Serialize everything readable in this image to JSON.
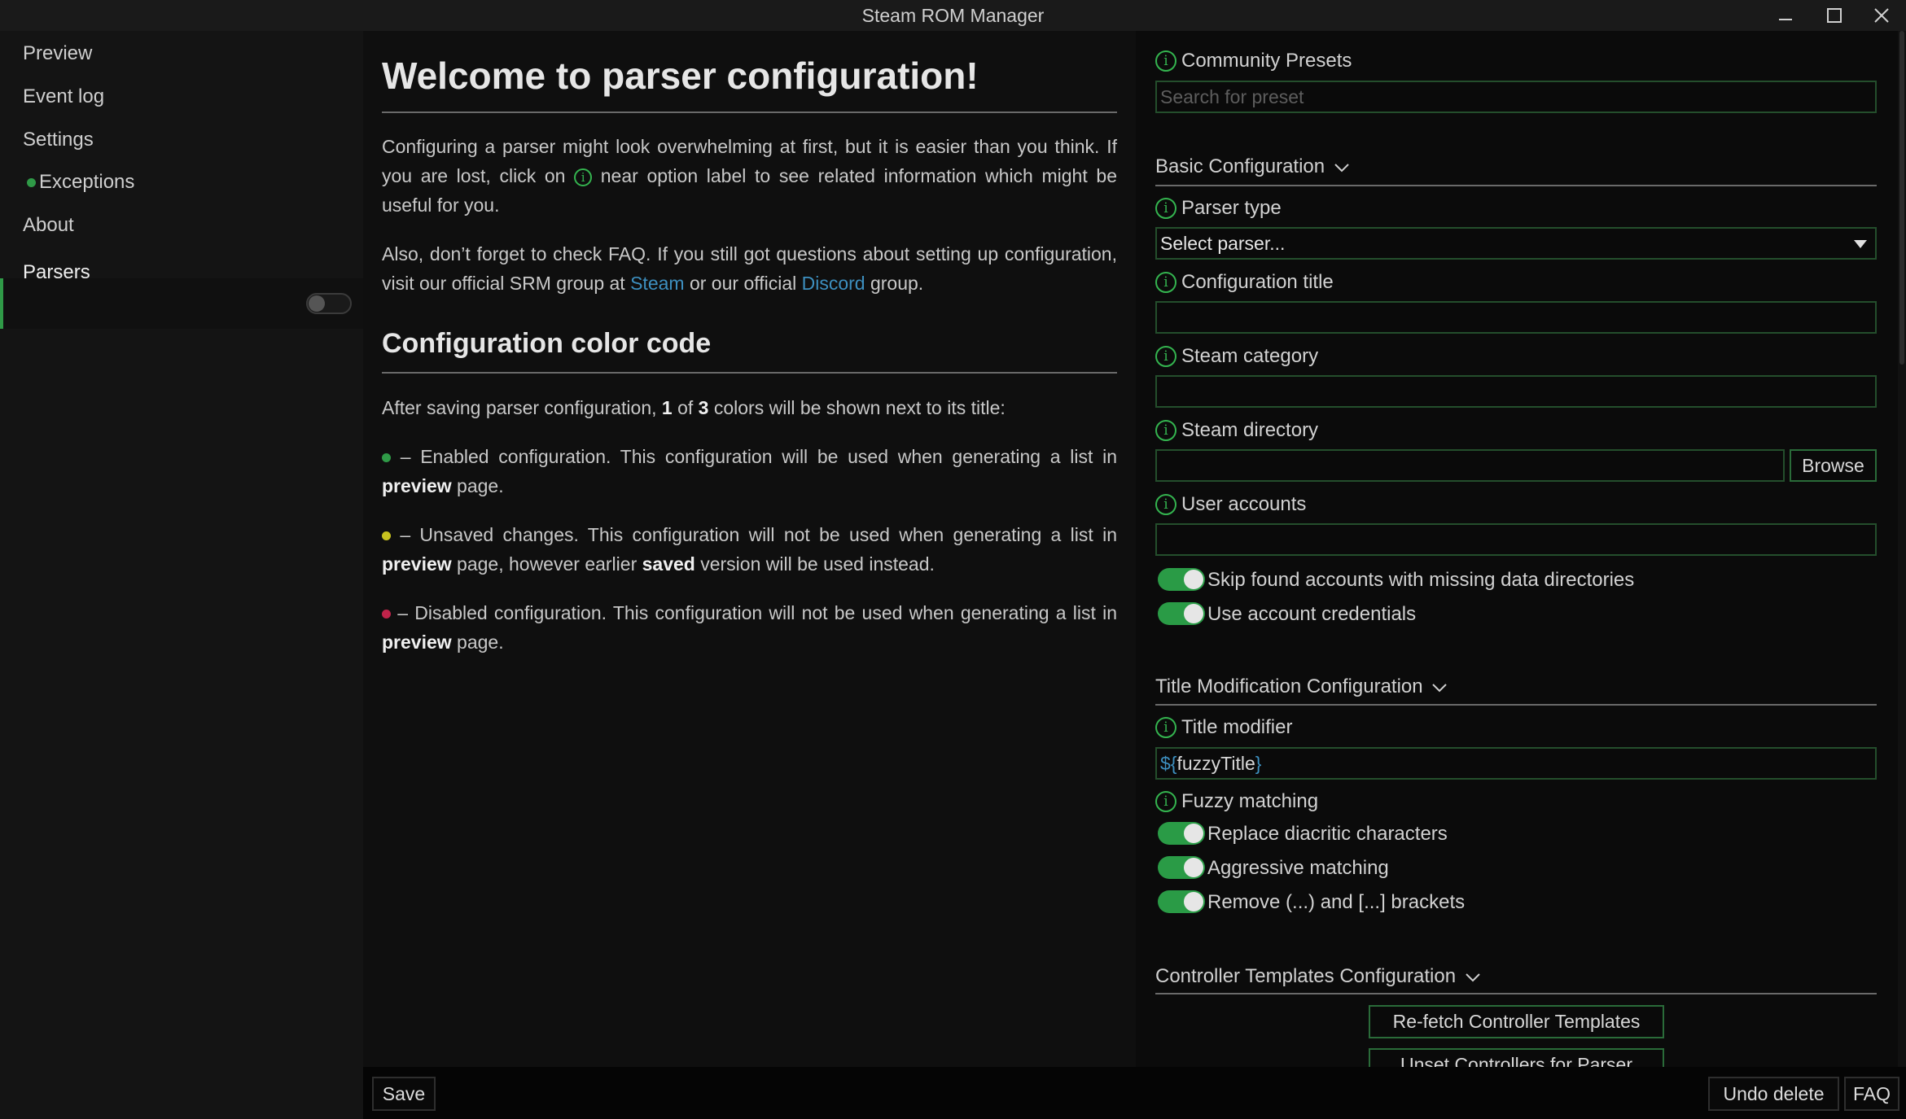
{
  "window": {
    "title": "Steam ROM Manager"
  },
  "sidebar": {
    "items": [
      {
        "label": "Preview"
      },
      {
        "label": "Event log"
      },
      {
        "label": "Settings"
      },
      {
        "label": "Exceptions"
      },
      {
        "label": "About"
      },
      {
        "label": "Parsers",
        "toggle_on": false
      }
    ]
  },
  "intro": {
    "title": "Welcome to parser configuration!",
    "p1_a": "Configuring a parser might look overwhelming at first, but it is easier than you think. If you are lost, click on ",
    "p1_b": " near option label to see related information which might be useful for you.",
    "p2_a": "Also, don’t forget to check FAQ. If you still got questions about setting up configuration, visit our official SRM group at ",
    "p2_steam": "Steam",
    "p2_b": " or our official ",
    "p2_discord": "Discord",
    "p2_c": " group."
  },
  "colorcode": {
    "title": "Configuration color code",
    "intro_a": "After saving parser configuration, ",
    "intro_one": "1",
    "intro_of": " of ",
    "intro_three": "3",
    "intro_b": " colors will be shown next to its title:",
    "enabled_a": " – Enabled configuration. This configuration will be used when generating a list in ",
    "enabled_bold": "preview",
    "enabled_b": " page.",
    "unsaved_a": " – Unsaved changes. This configuration will not be used when generating a list in ",
    "unsaved_bold1": "preview",
    "unsaved_b": " page, however earlier ",
    "unsaved_bold2": "saved",
    "unsaved_c": " version will be used instead.",
    "disabled_a": " – Disabled configuration. This configuration will not be used when generating a list in ",
    "disabled_bold": "preview",
    "disabled_b": " page."
  },
  "config": {
    "community_presets_label": "Community Presets",
    "search_placeholder": "Search for preset",
    "basic_section": "Basic Configuration",
    "parser_type_label": "Parser type",
    "parser_type_value": "Select parser...",
    "config_title_label": "Configuration title",
    "steam_category_label": "Steam category",
    "steam_directory_label": "Steam directory",
    "browse_label": "Browse",
    "user_accounts_label": "User accounts",
    "skip_found_label": "Skip found accounts with missing data directories",
    "use_credentials_label": "Use account credentials",
    "title_mod_section": "Title Modification Configuration",
    "title_modifier_label": "Title modifier",
    "title_modifier_prefix": "${",
    "title_modifier_var": "fuzzyTitle",
    "title_modifier_suffix": "}",
    "fuzzy_label": "Fuzzy matching",
    "replace_diacritic_label": "Replace diacritic characters",
    "aggressive_label": "Aggressive matching",
    "remove_brackets_label": "Remove (...) and [...] brackets",
    "controller_section": "Controller Templates Configuration",
    "refetch_label": "Re-fetch Controller Templates",
    "unset_label": "Unset Controllers for Parser"
  },
  "bottom": {
    "save_label": "Save",
    "undo_label": "Undo delete",
    "faq_label": "FAQ"
  },
  "colors": {
    "accent_green": "#2a9b46",
    "status_enabled": "#2f9a47",
    "status_unsaved": "#c8c21f",
    "status_disabled": "#c0234a",
    "link_blue": "#3d8fbf"
  }
}
